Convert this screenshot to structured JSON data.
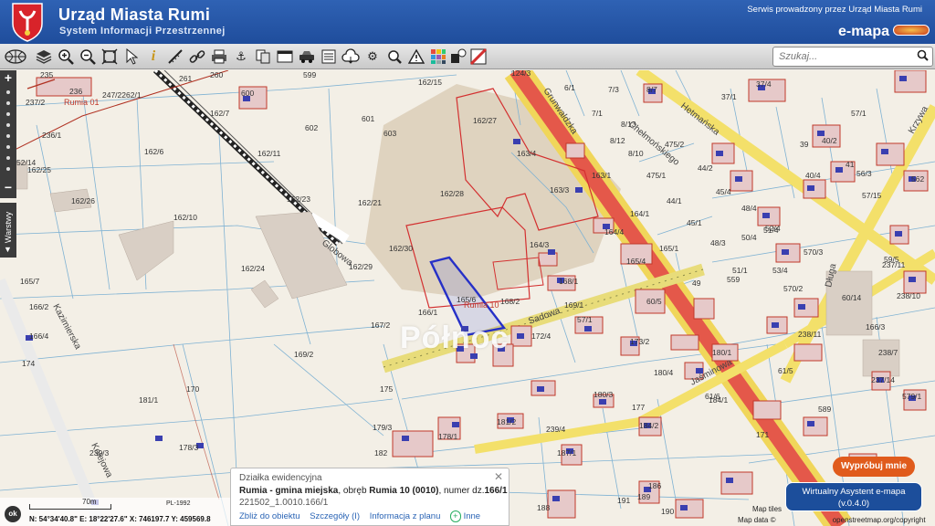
{
  "header": {
    "title": "Urząd Miasta Rumi",
    "subtitle": "System Informacji Przestrzennej",
    "service_note": "Serwis prowadzony przez Urząd Miasta Rumi",
    "brand": "e-mapa"
  },
  "toolbar": {
    "tools": [
      "globe-icon",
      "layers-icon",
      "zoom-in-icon",
      "zoom-out-icon",
      "zoom-extent-icon",
      "pointer-icon",
      "info-icon",
      "measure-icon",
      "link-icon",
      "print-icon",
      "anchor-icon",
      "copy-icon",
      "window-icon",
      "car-icon",
      "list-icon",
      "settings-icon",
      "search-map-icon",
      "warning-icon",
      "palette-icon",
      "shapes-icon",
      "flag-icon"
    ],
    "search_placeholder": "Szukaj..."
  },
  "sidebar": {
    "layers_label": "Warstwy"
  },
  "map": {
    "watermark": "Północ",
    "area_label": "Rumia 01",
    "parcel_highlight": "Rumia 10",
    "plot_numbers": [
      "235",
      "236",
      "247/2262/1",
      "261",
      "260",
      "599",
      "162/15",
      "124/3",
      "6/1",
      "7/3",
      "8/7",
      "37/1",
      "37/4",
      "237/2",
      "600",
      "162/7",
      "602",
      "601",
      "603",
      "162/27",
      "7/1",
      "8/13",
      "475/2",
      "39",
      "40/2",
      "57/1",
      "236/1",
      "162/6",
      "162/11",
      "163/4",
      "8/12",
      "8/10",
      "475/1",
      "44/2",
      "41",
      "56/3",
      "52/14",
      "162/25",
      "162/23",
      "162/21",
      "162/28",
      "163/3",
      "163/1",
      "45/4",
      "48/4",
      "51/4",
      "57/15",
      "162/26",
      "162/10",
      "44/1",
      "45/1",
      "50/4",
      "52/4",
      "40/4",
      "562",
      "162/24",
      "162/30",
      "164/3",
      "164/4",
      "164/1",
      "165/1",
      "48/3",
      "570/3",
      "59/5",
      "162/29",
      "165/4",
      "51/1",
      "53/4",
      "570/2",
      "237/11",
      "165/7",
      "168/1",
      "49",
      "559",
      "60/14",
      "238/10",
      "166/2",
      "166/1",
      "165/6",
      "168/2",
      "60/5",
      "166/3",
      "167/2",
      "169/1",
      "57/1",
      "238/11",
      "166/4",
      "169/2",
      "172/4",
      "173/2",
      "180/1",
      "61/5",
      "238/7",
      "174",
      "180/4",
      "61/6",
      "237/14",
      "170",
      "175",
      "180/3",
      "184/1",
      "589",
      "579/1",
      "181/1",
      "177",
      "181/2",
      "184/2",
      "171",
      "179/3",
      "239/4",
      "239/3",
      "178/3",
      "178/1",
      "182",
      "187/1",
      "186",
      "191",
      "188",
      "189",
      "190"
    ],
    "streets": [
      "Grunwaldzka",
      "Chełmońskiego",
      "Hetmańska",
      "Krzywa",
      "Globowa",
      "Kazimierska",
      "Sadowa",
      "Jaśminowa",
      "Długa",
      "Kolejowa"
    ]
  },
  "popup": {
    "heading": "Działka ewidencyjna",
    "gmina": "Rumia - gmina miejska",
    "obreb_prefix": ", obręb ",
    "obreb": "Rumia 10 (0010)",
    "nr_prefix": ", numer dz.",
    "nr": "166/1",
    "id": "221502_1.0010.166/1",
    "links": [
      "Zbliż do obiektu",
      "Szczegóły (I)",
      "Informacja z planu",
      "Inne"
    ]
  },
  "scale": {
    "label": "70m",
    "crs": "PL-1992"
  },
  "coords": "N: 54°34'40.8\" E: 18°22'27.6\" X: 746197.7 Y: 459569.8",
  "buttons": {
    "ok": "ok",
    "try": "Wypróbuj mnie",
    "assistant_line1": "Wirtualny Asystent e-mapa",
    "assistant_line2": "(v.0.4.0)"
  },
  "attribution": {
    "tiles": "Map tiles",
    "data": "Map data ©",
    "osm": "openstreetmap.org/copyright"
  },
  "colors": {
    "header": "#2f62b4",
    "parcel_red": "#d33030",
    "road_main": "#e74c3c",
    "road_yellow": "#f5e05a",
    "highlight_blue": "#2630c7"
  }
}
